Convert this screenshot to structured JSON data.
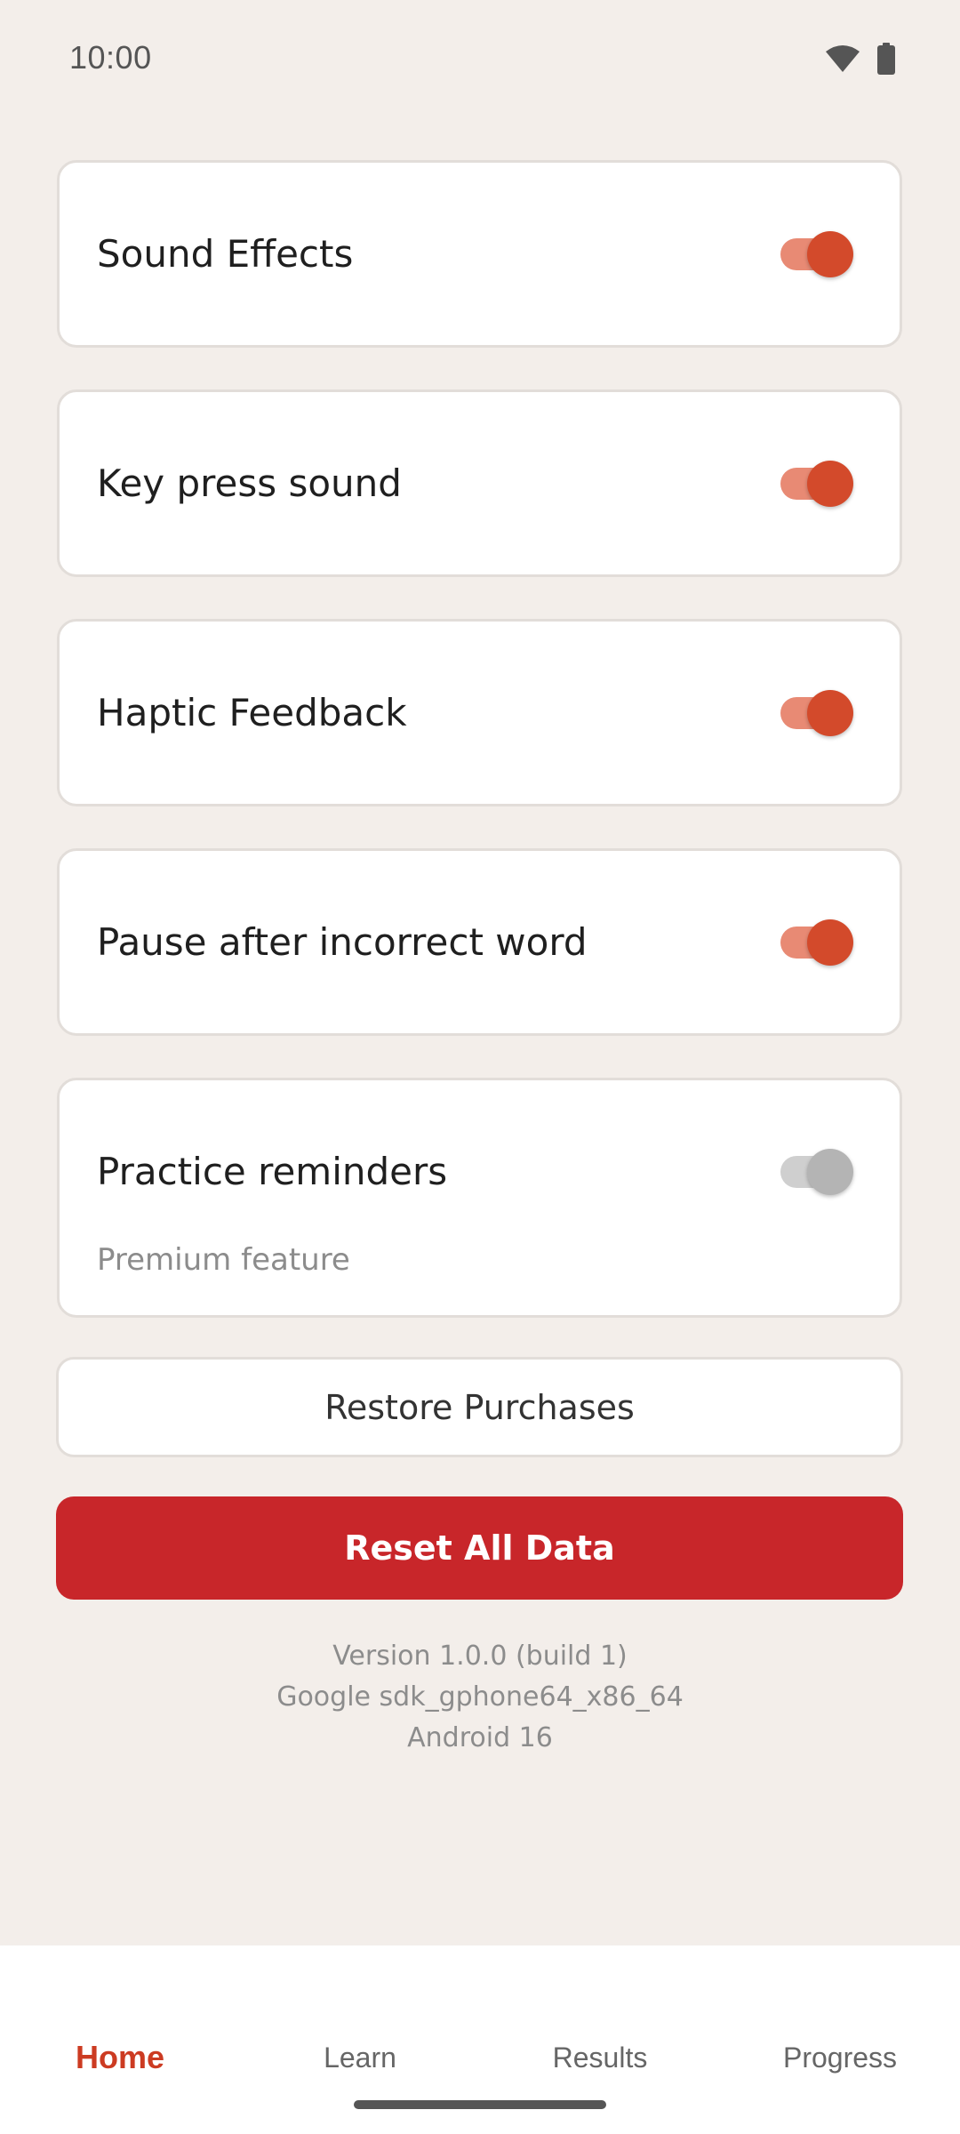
{
  "status_bar": {
    "time": "10:00",
    "icons": [
      "wifi-icon",
      "battery-icon"
    ]
  },
  "settings": [
    {
      "label": "Sound Effects",
      "enabled": true
    },
    {
      "label": "Key press sound",
      "enabled": true
    },
    {
      "label": "Haptic Feedback",
      "enabled": true
    },
    {
      "label": "Pause after incorrect word",
      "enabled": true
    },
    {
      "label": "Practice reminders",
      "enabled": false,
      "subtitle": "Premium feature"
    }
  ],
  "buttons": {
    "restore_label": "Restore Purchases",
    "reset_label": "Reset All Data"
  },
  "version_info": {
    "version": "Version 1.0.0 (build 1)",
    "device": "Google sdk_gphone64_x86_64",
    "os": "Android 16"
  },
  "bottom_nav": {
    "items": [
      {
        "label": "Home",
        "active": true
      },
      {
        "label": "Learn",
        "active": false
      },
      {
        "label": "Results",
        "active": false
      },
      {
        "label": "Progress",
        "active": false
      }
    ]
  },
  "colors": {
    "background": "#f3eeea",
    "accent": "#d34a2b",
    "accent_track": "#e88a74",
    "danger": "#c8262a",
    "nav_active": "#cc3b22"
  }
}
